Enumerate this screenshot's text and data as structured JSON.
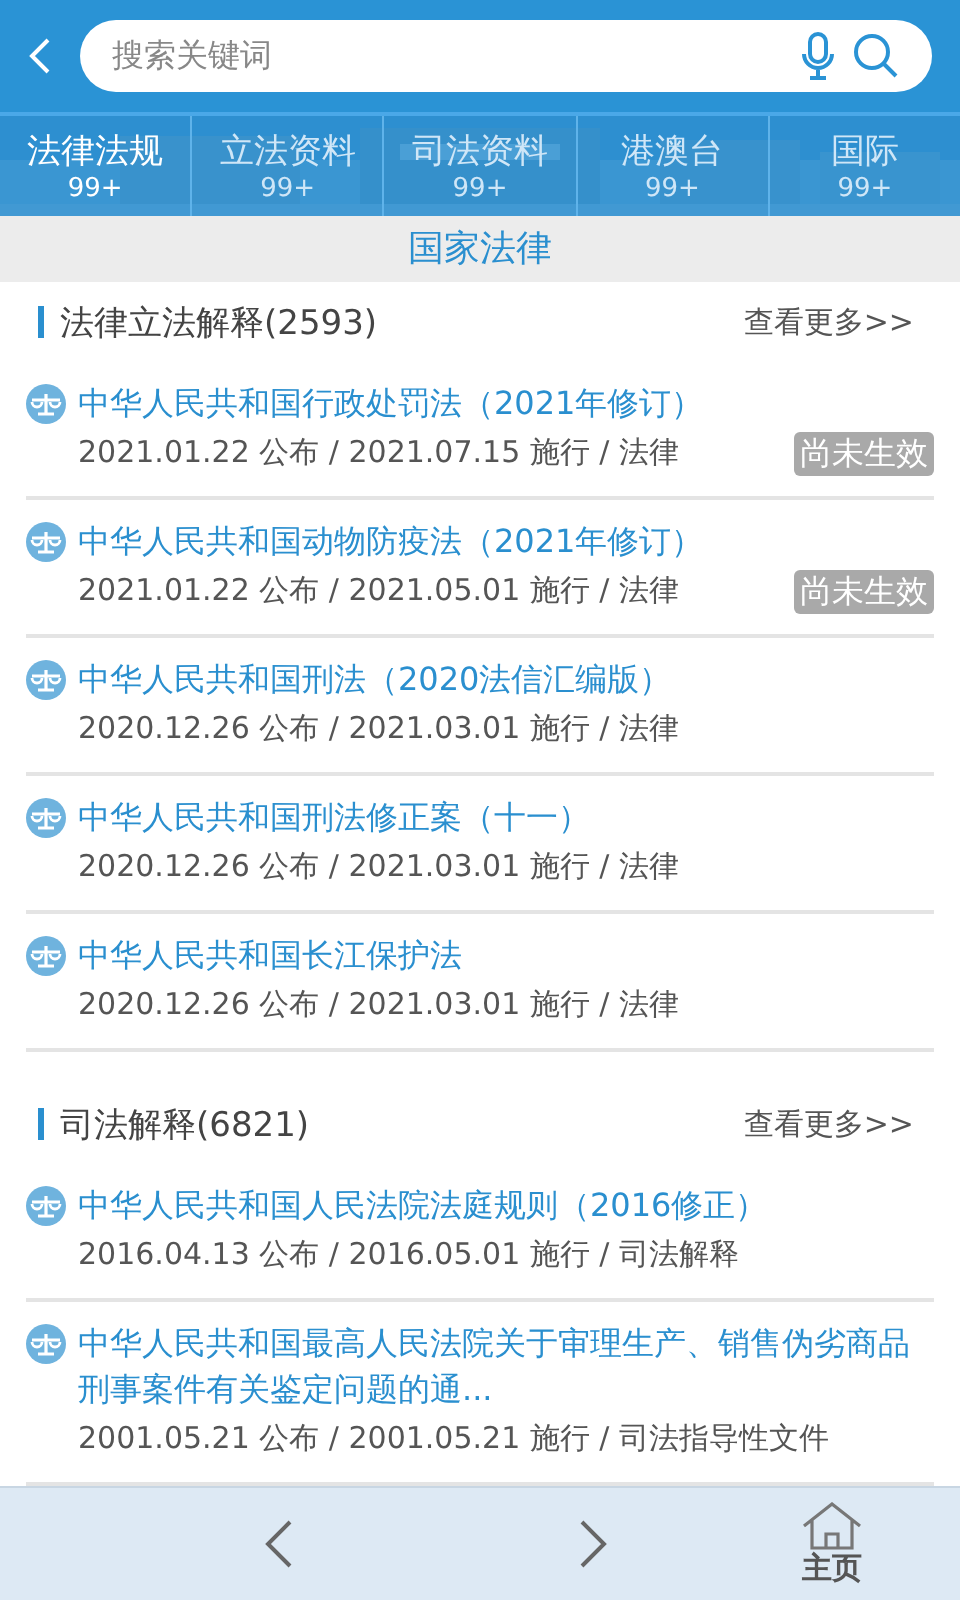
{
  "search": {
    "placeholder": "搜索关键词"
  },
  "tabs": [
    {
      "label": "法律法规",
      "count": "99+",
      "selected": true
    },
    {
      "label": "立法资料",
      "count": "99+",
      "selected": false
    },
    {
      "label": "司法资料",
      "count": "99+",
      "selected": false
    },
    {
      "label": "港澳台",
      "count": "99+",
      "selected": false
    },
    {
      "label": "国际",
      "count": "99+",
      "selected": false
    }
  ],
  "category_title": "国家法律",
  "sections": [
    {
      "title": "法律立法解释(2593)",
      "more": "查看更多>>",
      "items": [
        {
          "title": "中华人民共和国行政处罚法（2021年修订）",
          "meta": "2021.01.22 公布 / 2021.07.15 施行 / 法律",
          "badge": "尚未生效"
        },
        {
          "title": "中华人民共和国动物防疫法（2021年修订）",
          "meta": "2021.01.22 公布 / 2021.05.01 施行 / 法律",
          "badge": "尚未生效"
        },
        {
          "title": "中华人民共和国刑法（2020法信汇编版）",
          "meta": "2020.12.26 公布 / 2021.03.01 施行 / 法律"
        },
        {
          "title": "中华人民共和国刑法修正案（十一）",
          "meta": "2020.12.26 公布 / 2021.03.01 施行 / 法律"
        },
        {
          "title": "中华人民共和国长江保护法",
          "meta": "2020.12.26 公布 / 2021.03.01 施行 / 法律"
        }
      ]
    },
    {
      "title": "司法解释(6821)",
      "more": "查看更多>>",
      "items": [
        {
          "title": "中华人民共和国人民法院法庭规则（2016修正）",
          "meta": "2016.04.13 公布 / 2016.05.01 施行 / 司法解释"
        },
        {
          "title": "中华人民共和国最高人民法院关于审理生产、销售伪劣商品刑事案件有关鉴定问题的通...",
          "meta": "2001.05.21 公布 / 2001.05.21 施行 / 司法指导性文件"
        }
      ]
    }
  ],
  "bottom_nav": {
    "home_label": "主页"
  }
}
